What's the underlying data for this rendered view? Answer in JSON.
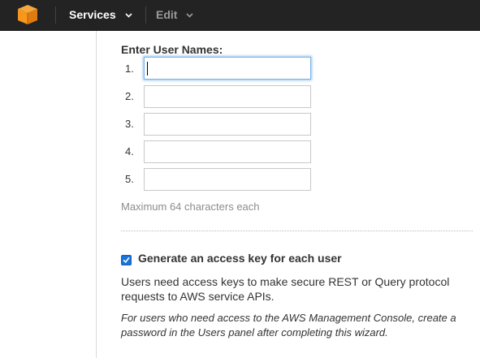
{
  "nav": {
    "services_label": "Services",
    "edit_label": "Edit"
  },
  "form": {
    "title": "Enter User Names:",
    "rows": [
      {
        "number": "1.",
        "value": "",
        "focused": true
      },
      {
        "number": "2.",
        "value": "",
        "focused": false
      },
      {
        "number": "3.",
        "value": "",
        "focused": false
      },
      {
        "number": "4.",
        "value": "",
        "focused": false
      },
      {
        "number": "5.",
        "value": "",
        "focused": false
      }
    ],
    "hint": "Maximum 64 characters each"
  },
  "access_key": {
    "checked": true,
    "label": "Generate an access key for each user",
    "description": "Users need access keys to make secure REST or Query protocol requests to AWS service APIs.",
    "note": "For users who need access to the AWS Management Console, create a password in the Users panel after completing this wizard."
  },
  "colors": {
    "topbar_bg": "#232323",
    "logo_orange": "#f7981d",
    "checkbox_blue": "#1a73d9",
    "focus_glow": "#62a3e3"
  },
  "icons": {
    "logo": "aws-cube-icon",
    "services_caret": "chevron-down-icon",
    "edit_caret": "chevron-down-icon",
    "checkbox_mark": "checkmark-icon"
  }
}
